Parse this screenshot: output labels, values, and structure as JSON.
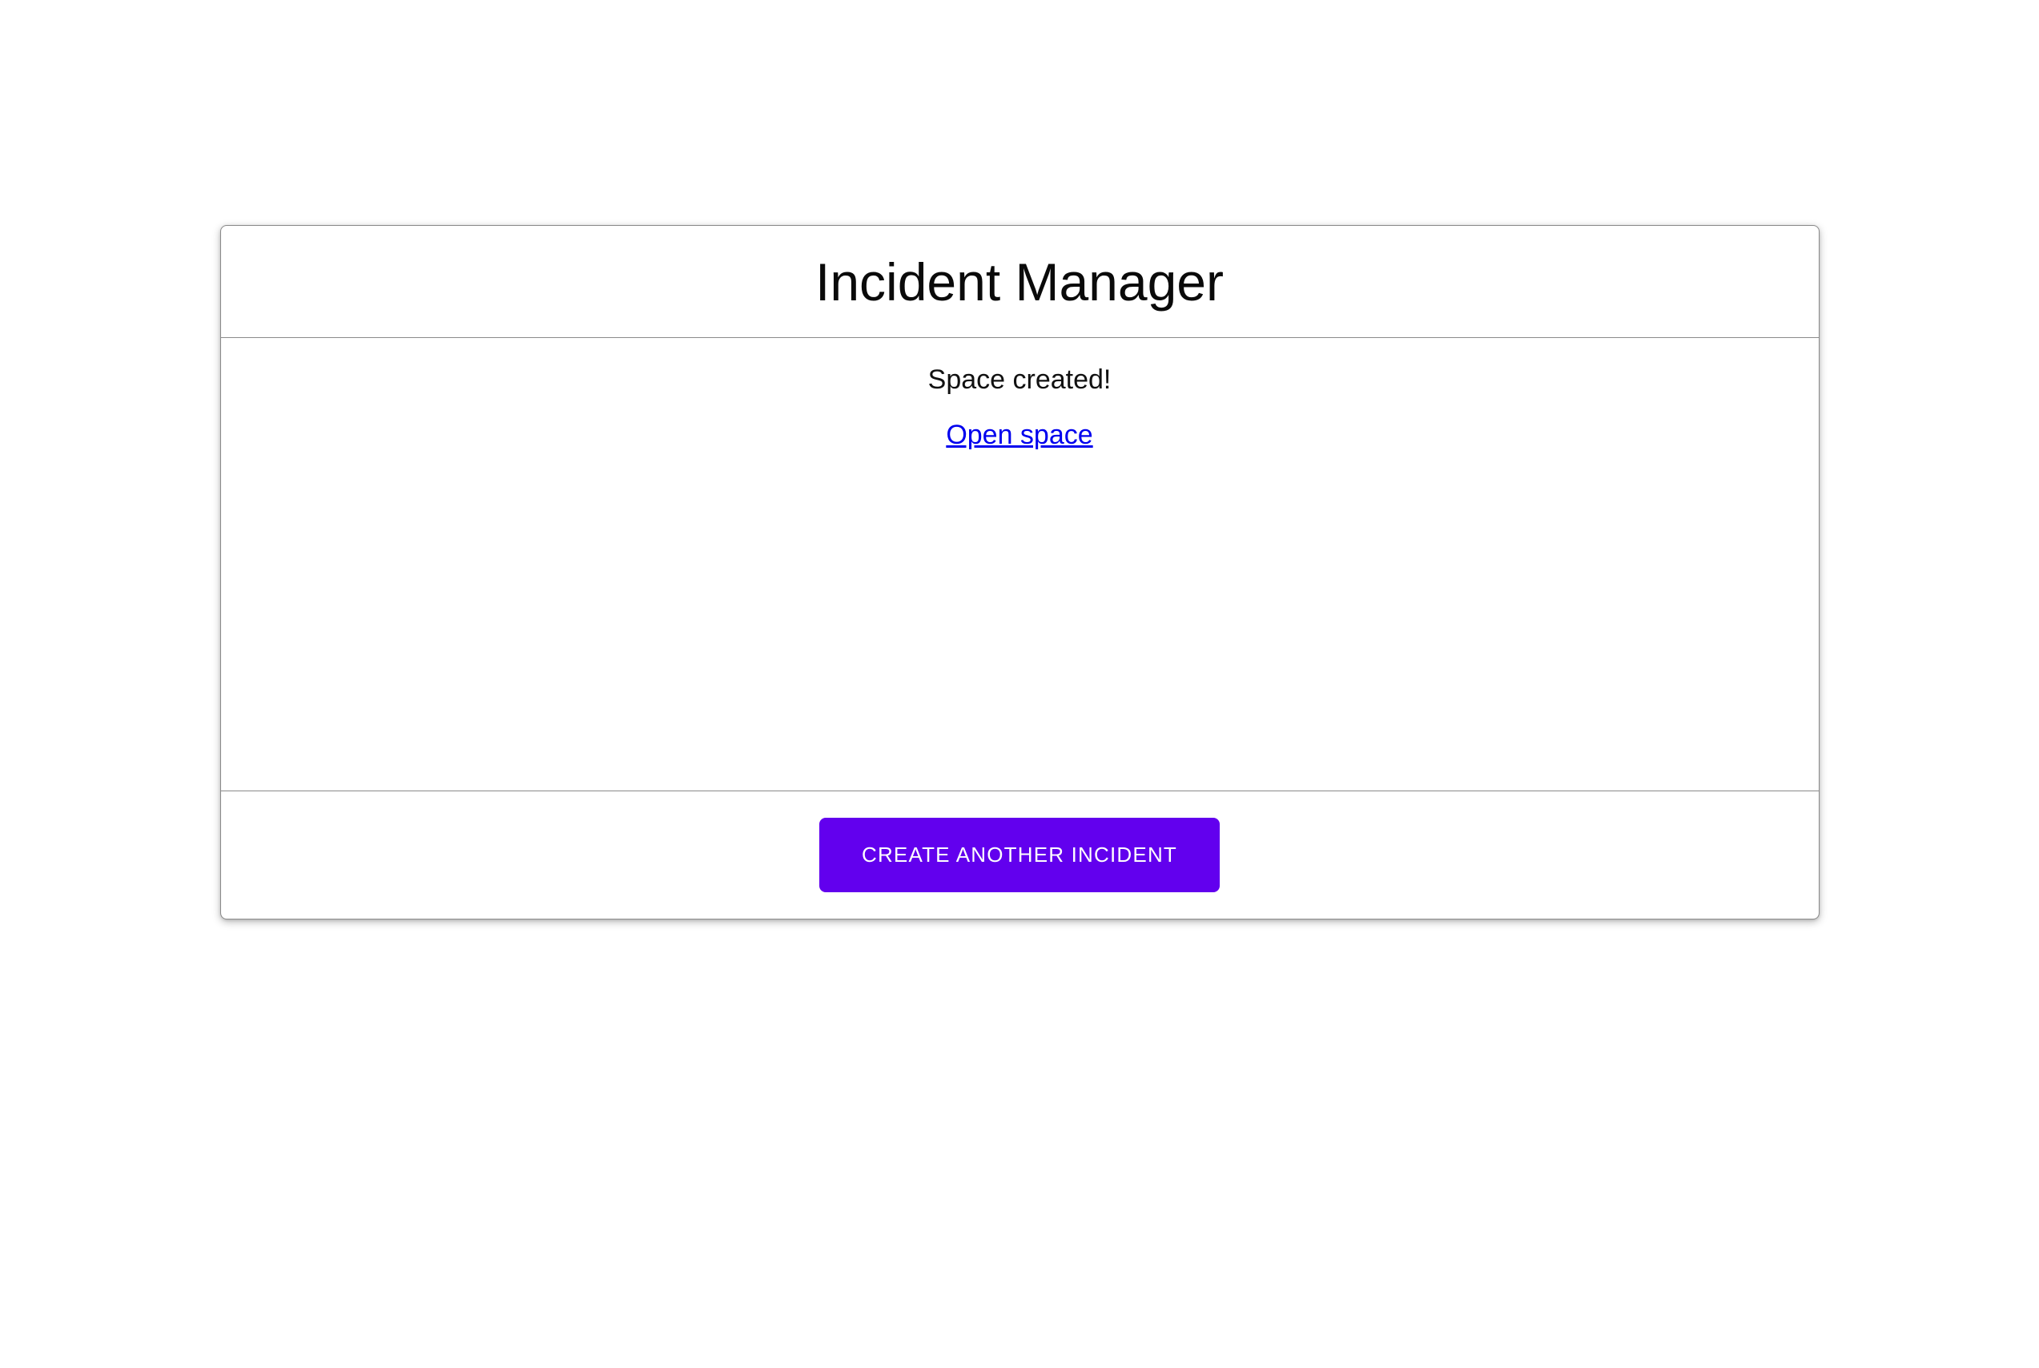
{
  "app": {
    "title": "Incident Manager"
  },
  "content": {
    "status_message": "Space created!",
    "open_space_link_label": "Open space"
  },
  "footer": {
    "create_button_label": "CREATE ANOTHER INCIDENT"
  },
  "colors": {
    "accent": "#6200ee",
    "link": "#0000ee",
    "border": "#8a8a8a",
    "button_text": "#ffffff",
    "page_background": "#ffffff"
  }
}
